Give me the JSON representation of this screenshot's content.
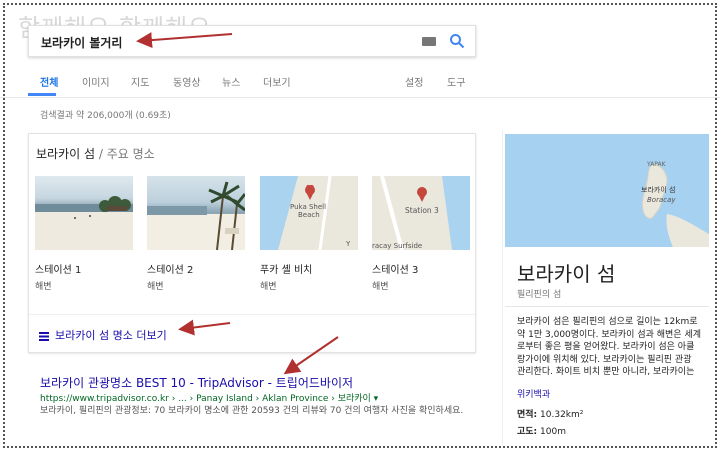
{
  "watermark": "함께해요 함께해요",
  "search": {
    "query": "보라카이 볼거리"
  },
  "tabs": [
    {
      "label": "전체",
      "active": true
    },
    {
      "label": "이미지"
    },
    {
      "label": "지도"
    },
    {
      "label": "동영상"
    },
    {
      "label": "뉴스"
    },
    {
      "label": "더보기"
    },
    {
      "label": "설정"
    },
    {
      "label": "도구"
    }
  ],
  "result_stats": "검색결과 약 206,000개 (0.69초)",
  "places": {
    "title": "보라카이 섬",
    "subtitle": " / 주요 명소",
    "items": [
      {
        "name": "스테이션 1",
        "type": "해변"
      },
      {
        "name": "스테이션 2",
        "type": "해변"
      },
      {
        "name": "푸카 셸 비치",
        "type": "해변",
        "map_label": "Puka Shell\nBeach"
      },
      {
        "name": "스테이션 3",
        "type": "해변",
        "map_label": "Station 3",
        "map_label2": "racay Surfside"
      }
    ],
    "more_link": "보라카이 섬 명소 더보기"
  },
  "result": {
    "title": "보라카이 관광명소 BEST 10 - TripAdvisor - 트립어드바이저",
    "url": "https://www.tripadvisor.co.kr › ... › Panay Island › Aklan Province › 보라카이 ▾",
    "snippet": "보라카이, 필리핀의 관광정보: 70 보라카이 명소에 관한 20593 건의 리뷰와 70 건의 여행자 사진을 확인하세요."
  },
  "knowledge_panel": {
    "map_label_en": "Boracay",
    "map_label_ko": "보라카이 섬",
    "map_label_yapak": "YAPAK",
    "title": "보라카이 섬",
    "subtitle": "필리핀의 섬",
    "description": "보라카이 섬은 필리핀의 섬으로 길이는 12km로\n약 1만 3,000명이다. 보라카이 섬과 해변은 세계\n로부터 좋은 평을 얻어왔다. 보라카이 섬은 아클\n랑가이에 위치해 있다. 보라카이는 필리핀 관광\n관리한다. 화이트 비치 뿐만 아니라, 보라카이는\n양지이다. 또한, 밤에는 해변가에 위치한 클럽,",
    "wiki_link": "위키백과",
    "facts": [
      {
        "label": "면적:",
        "value": " 10.32km²"
      },
      {
        "label": "고도:",
        "value": " 100m"
      }
    ]
  },
  "colors": {
    "link": "#1a0dab",
    "url": "#006621",
    "accent": "#4285f4",
    "arrow": "#b0312f"
  }
}
